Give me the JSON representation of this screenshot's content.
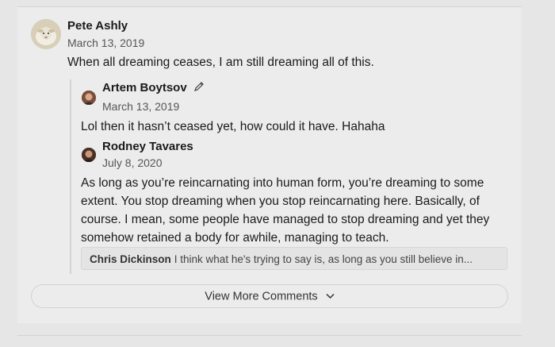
{
  "comments": [
    {
      "author": "Pete Ashly",
      "date": "March 13, 2019",
      "text": "When all dreaming ceases, I am still dreaming all of this."
    },
    {
      "author": "Artem Boytsov",
      "date": "March 13, 2019",
      "text": "Lol then it hasn’t ceased yet, how could it have. Hahaha",
      "badge_icon": "pencil-icon"
    },
    {
      "author": "Rodney Tavares",
      "date": "July 8, 2020",
      "lines": [
        "As long as you’re reincarnating into human form, you’re dreaming to some",
        "extent. You stop dreaming when you stop reincarnating here. Basically, of",
        "course. I mean, some people have managed to stop dreaming and yet they",
        "somehow retained a body for awhile, managing to teach."
      ]
    }
  ],
  "reply_preview": {
    "author": "Chris Dickinson",
    "text": "I think what he's trying to say is, as long as you still believe in..."
  },
  "view_more": {
    "label": "View More Comments",
    "icon": "chevron-down-icon"
  }
}
